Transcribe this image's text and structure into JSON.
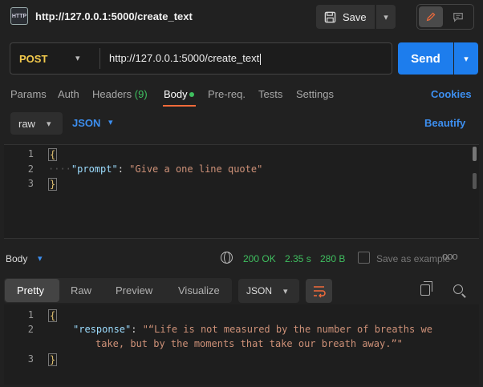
{
  "header": {
    "icon_text": "HTTP",
    "title": "http://127.0.0.1:5000/create_text",
    "save_label": "Save"
  },
  "request": {
    "method": "POST",
    "url": "http://127.0.0.1:5000/create_text",
    "send_label": "Send"
  },
  "tabs": {
    "params": "Params",
    "auth": "Auth",
    "headers": "Headers",
    "headers_count": "(9)",
    "body": "Body",
    "prereq": "Pre-req.",
    "tests": "Tests",
    "settings": "Settings",
    "cookies": "Cookies"
  },
  "body_options": {
    "mode": "raw",
    "language": "JSON",
    "beautify": "Beautify"
  },
  "request_body": {
    "line_numbers": [
      "1",
      "2",
      "3"
    ],
    "open_brace": "{",
    "key": "\"prompt\"",
    "colon": ": ",
    "value": "\"Give a one line quote\"",
    "close_brace": "}",
    "indent_dots": "····"
  },
  "response": {
    "label": "Body",
    "status": "200 OK",
    "time": "2.35 s",
    "size": "280 B",
    "save_example": "Save as example",
    "tabs": {
      "pretty": "Pretty",
      "raw": "Raw",
      "preview": "Preview",
      "visualize": "Visualize"
    },
    "format": "JSON",
    "line_numbers": [
      "1",
      "2",
      "3"
    ],
    "open_brace": "{",
    "key": "\"response\"",
    "colon": ": ",
    "value_line1": "\"“Life is not measured by the number of breaths we",
    "value_line2": "take, but by the moments that take our breath away.”\"",
    "close_brace": "}"
  },
  "colors": {
    "accent_orange": "#f26b3a",
    "send_blue": "#1d7ded",
    "link_blue": "#3d8ff0",
    "status_green": "#3fbf5f",
    "method_yellow": "#f2c94c"
  },
  "icons": [
    "http-icon",
    "save-icon",
    "chevron-down-icon",
    "pencil-icon",
    "comment-icon",
    "globe-icon",
    "save-example-icon",
    "more-icon",
    "wrap-icon",
    "copy-icon",
    "search-icon"
  ]
}
